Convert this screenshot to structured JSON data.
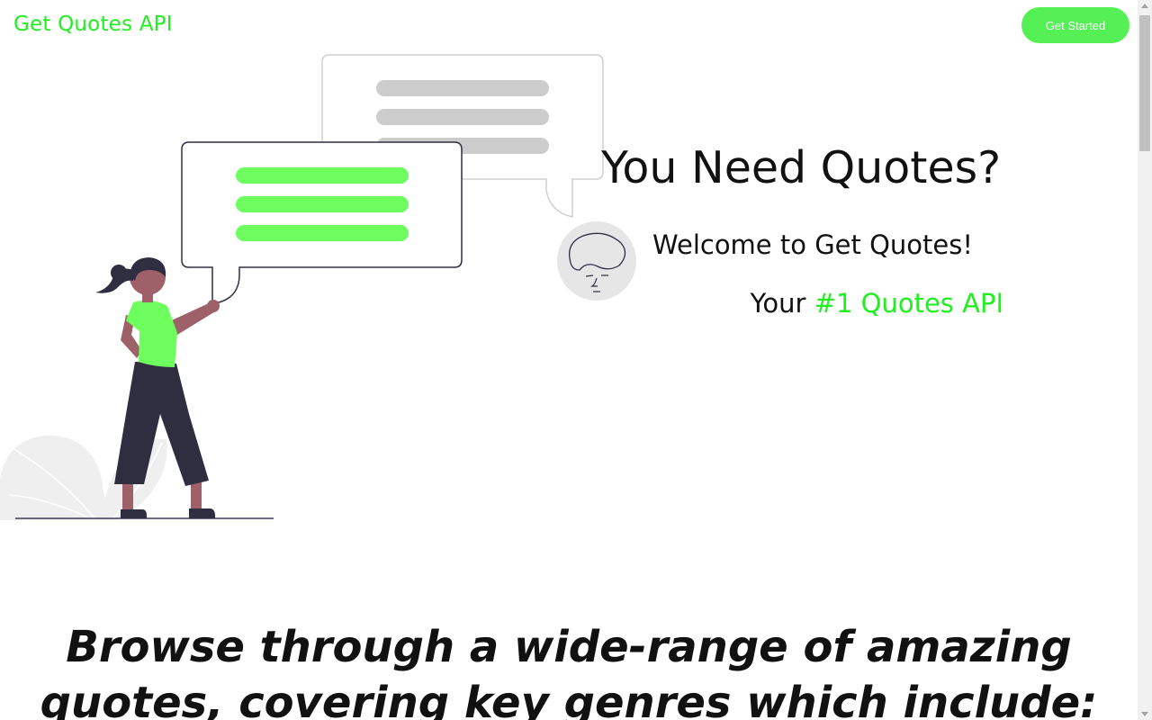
{
  "header": {
    "brand": "Get Quotes API",
    "cta_label": "Get Started"
  },
  "hero": {
    "title": "You Need Quotes?",
    "welcome": "Welcome to Get Quotes!",
    "tagline_prefix": "Your",
    "tagline_accent": "#1 Quotes API"
  },
  "browse": {
    "text": "Browse through a wide-range of amazing quotes, covering key genres which include:"
  },
  "colors": {
    "accent": "#22ee22",
    "button": "#55f055",
    "bubble_lines_green": "#6eff5e",
    "bubble_lines_gray": "#cccccc",
    "text": "#111111"
  },
  "icons": {
    "illustration": "woman-with-speech-bubbles-illustration",
    "avatar": "face-sketch-avatar-icon"
  }
}
